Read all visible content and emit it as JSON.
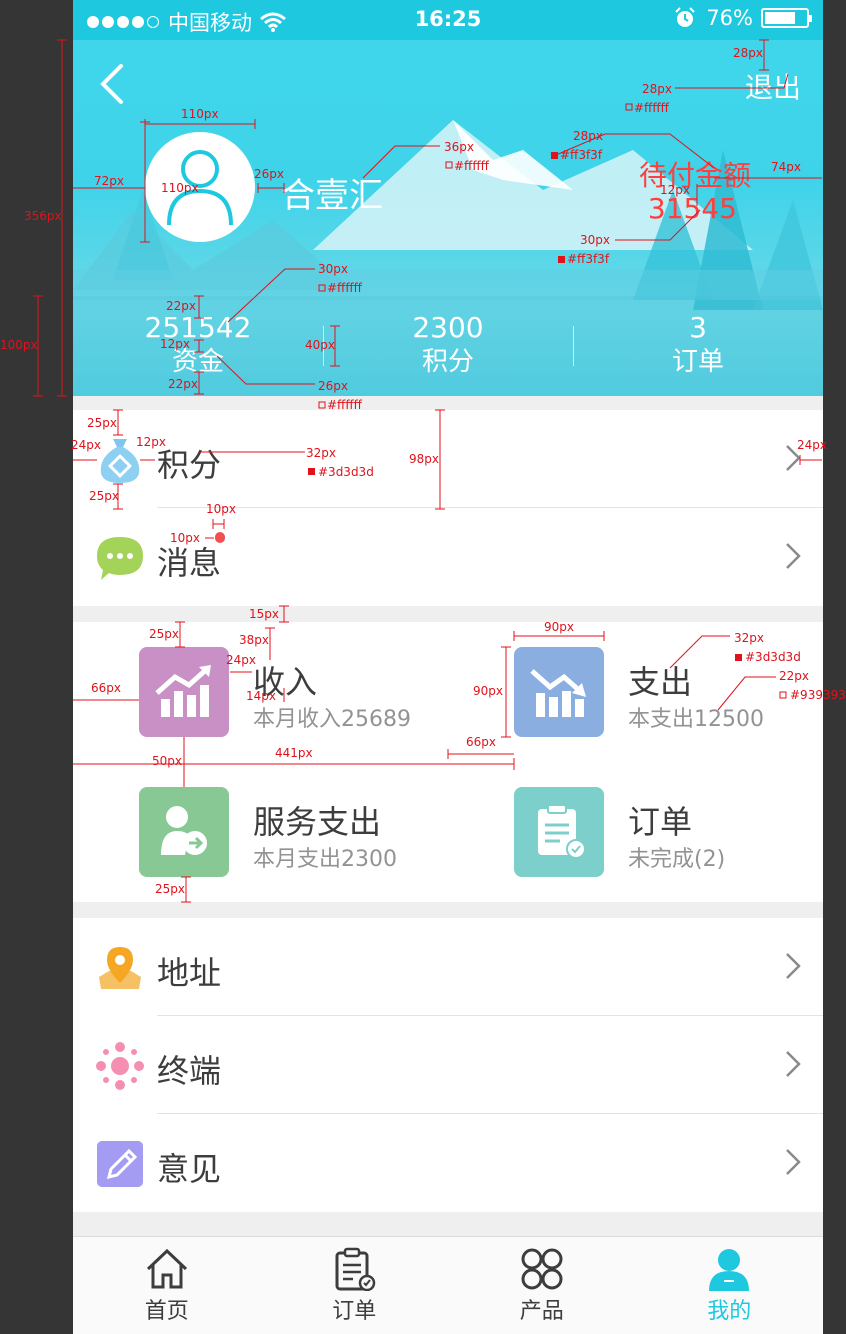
{
  "status": {
    "carrier": "中国移动",
    "time": "16:25",
    "battery": "76%",
    "battery_level": 0.76
  },
  "header": {
    "logout": "退出",
    "username": "合壹汇",
    "pending_label": "待付金额",
    "pending_value": "31545",
    "stats": [
      {
        "value": "251542",
        "label": "资金"
      },
      {
        "value": "2300",
        "label": "积分"
      },
      {
        "value": "3",
        "label": "订单"
      }
    ]
  },
  "menu1": {
    "points": "积分",
    "messages": "消息"
  },
  "tiles": [
    {
      "title": "收入",
      "subtitle": "本月收入25689",
      "color": "#c890c4",
      "icon": "chart-up-icon"
    },
    {
      "title": "支出",
      "subtitle": "本支出12500",
      "color": "#8aaee0",
      "icon": "chart-down-icon"
    },
    {
      "title": "服务支出",
      "subtitle": "本月支出2300",
      "color": "#88c895",
      "icon": "user-transfer-icon"
    },
    {
      "title": "订单",
      "subtitle": "未完成(2)",
      "color": "#7ccfcb",
      "icon": "clipboard-check-icon"
    }
  ],
  "menu2": {
    "address": "地址",
    "terminal": "终端",
    "feedback": "意见"
  },
  "tabs": [
    {
      "label": "首页",
      "icon": "home-icon"
    },
    {
      "label": "订单",
      "icon": "order-icon"
    },
    {
      "label": "产品",
      "icon": "product-icon"
    },
    {
      "label": "我的",
      "icon": "profile-icon"
    }
  ],
  "colors": {
    "accent": "#1ec9e0",
    "pending": "#ff3f3f",
    "text": "#3d3d3d",
    "subtext": "#939393"
  },
  "annotations": {
    "a1": "28px",
    "a2": "28px",
    "a3": "#ffffff",
    "a4": "110px",
    "a5": "36px",
    "a6": "#ffffff",
    "a7": "28px",
    "a8": "#ff3f3f",
    "a9": "72px",
    "a10": "110px",
    "a11": "26px",
    "a12": "74px",
    "a13": "12px",
    "a14": "30px",
    "a15": "#ff3f3f",
    "a16": "356px",
    "a17": "30px",
    "a18": "#ffffff",
    "a19": "22px",
    "a20": "12px",
    "a21": "40px",
    "a22": "100px",
    "a23": "22px",
    "a24": "26px",
    "a25": "#ffffff",
    "a26": "25px",
    "a27": "24px",
    "a28": "12px",
    "a29": "32px",
    "a30": "#3d3d3d",
    "a31": "98px",
    "a32": "24px",
    "a33": "25px",
    "a34": "10px",
    "a35": "10px",
    "a36": "15px",
    "a37": "90px",
    "a38": "25px",
    "a39": "38px",
    "a40": "32px",
    "a41": "#3d3d3d",
    "a42": "24px",
    "a43": "22px",
    "a44": "#939393",
    "a45": "66px",
    "a46": "14px",
    "a47": "90px",
    "a48": "50px",
    "a49": "441px",
    "a50": "66px",
    "a51": "25px"
  }
}
